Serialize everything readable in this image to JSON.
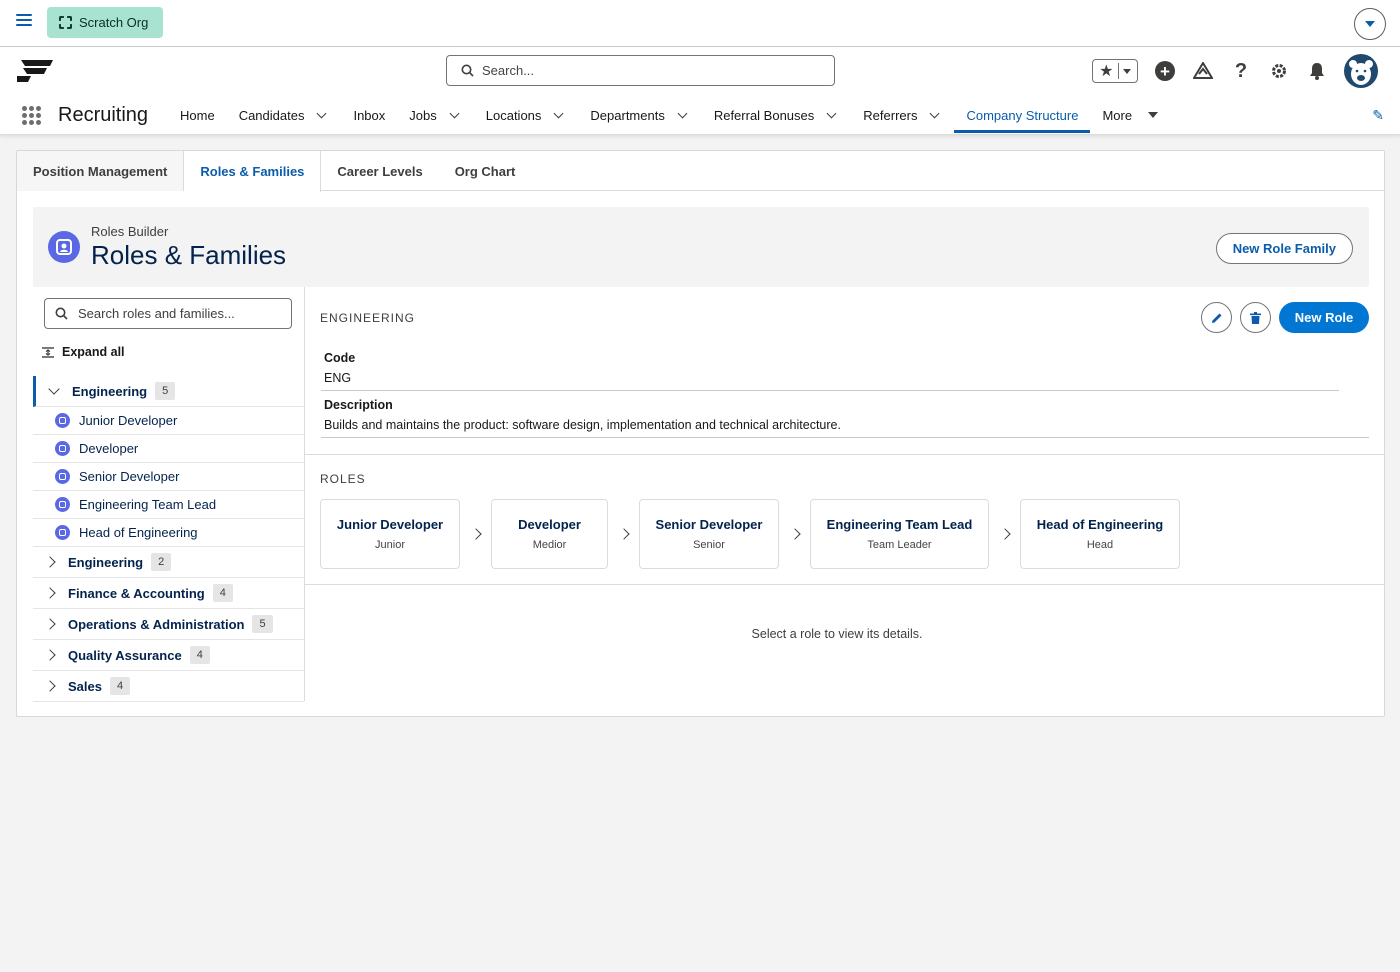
{
  "org": {
    "label": "Scratch Org"
  },
  "header": {
    "search_placeholder": "Search..."
  },
  "nav": {
    "app_name": "Recruiting",
    "items": [
      {
        "label": "Home",
        "has_menu": false
      },
      {
        "label": "Candidates",
        "has_menu": true
      },
      {
        "label": "Inbox",
        "has_menu": false
      },
      {
        "label": "Jobs",
        "has_menu": true
      },
      {
        "label": "Locations",
        "has_menu": true
      },
      {
        "label": "Departments",
        "has_menu": true
      },
      {
        "label": "Referral Bonuses",
        "has_menu": true
      },
      {
        "label": "Referrers",
        "has_menu": true
      },
      {
        "label": "Company Structure",
        "has_menu": false,
        "active": true
      },
      {
        "label": "More",
        "has_menu": true
      }
    ]
  },
  "tabs": [
    "Position Management",
    "Roles & Families",
    "Career Levels",
    "Org Chart"
  ],
  "page": {
    "subtitle": "Roles Builder",
    "title": "Roles & Families",
    "new_family_label": "New Role Family"
  },
  "tree": {
    "search_placeholder": "Search roles and families...",
    "expand_all_label": "Expand all",
    "expanded": {
      "label": "Engineering",
      "count": "5",
      "children": [
        "Junior Developer",
        "Developer",
        "Senior Developer",
        "Engineering Team Lead",
        "Head of Engineering"
      ]
    },
    "collapsed": [
      {
        "label": "Engineering",
        "count": "2"
      },
      {
        "label": "Finance & Accounting",
        "count": "4"
      },
      {
        "label": "Operations & Administration",
        "count": "5"
      },
      {
        "label": "Quality Assurance",
        "count": "4"
      },
      {
        "label": "Sales",
        "count": "4"
      }
    ]
  },
  "detail": {
    "family_heading": "ENGINEERING",
    "new_role_label": "New Role",
    "code_label": "Code",
    "code_value": "ENG",
    "description_label": "Description",
    "description_value": "Builds and maintains the product: software design, implementation and technical architecture.",
    "roles_heading": "ROLES",
    "roles": [
      {
        "name": "Junior Developer",
        "level": "Junior"
      },
      {
        "name": "Developer",
        "level": "Medior"
      },
      {
        "name": "Senior Developer",
        "level": "Senior"
      },
      {
        "name": "Engineering Team Lead",
        "level": "Team Leader"
      },
      {
        "name": "Head of Engineering",
        "level": "Head"
      }
    ],
    "empty_message": "Select a role to view its details."
  },
  "colors": {
    "brand": "#0176d3",
    "link": "#0b5cab",
    "org_badge": "#a8e3d2",
    "role_icon": "#5a68e5"
  }
}
